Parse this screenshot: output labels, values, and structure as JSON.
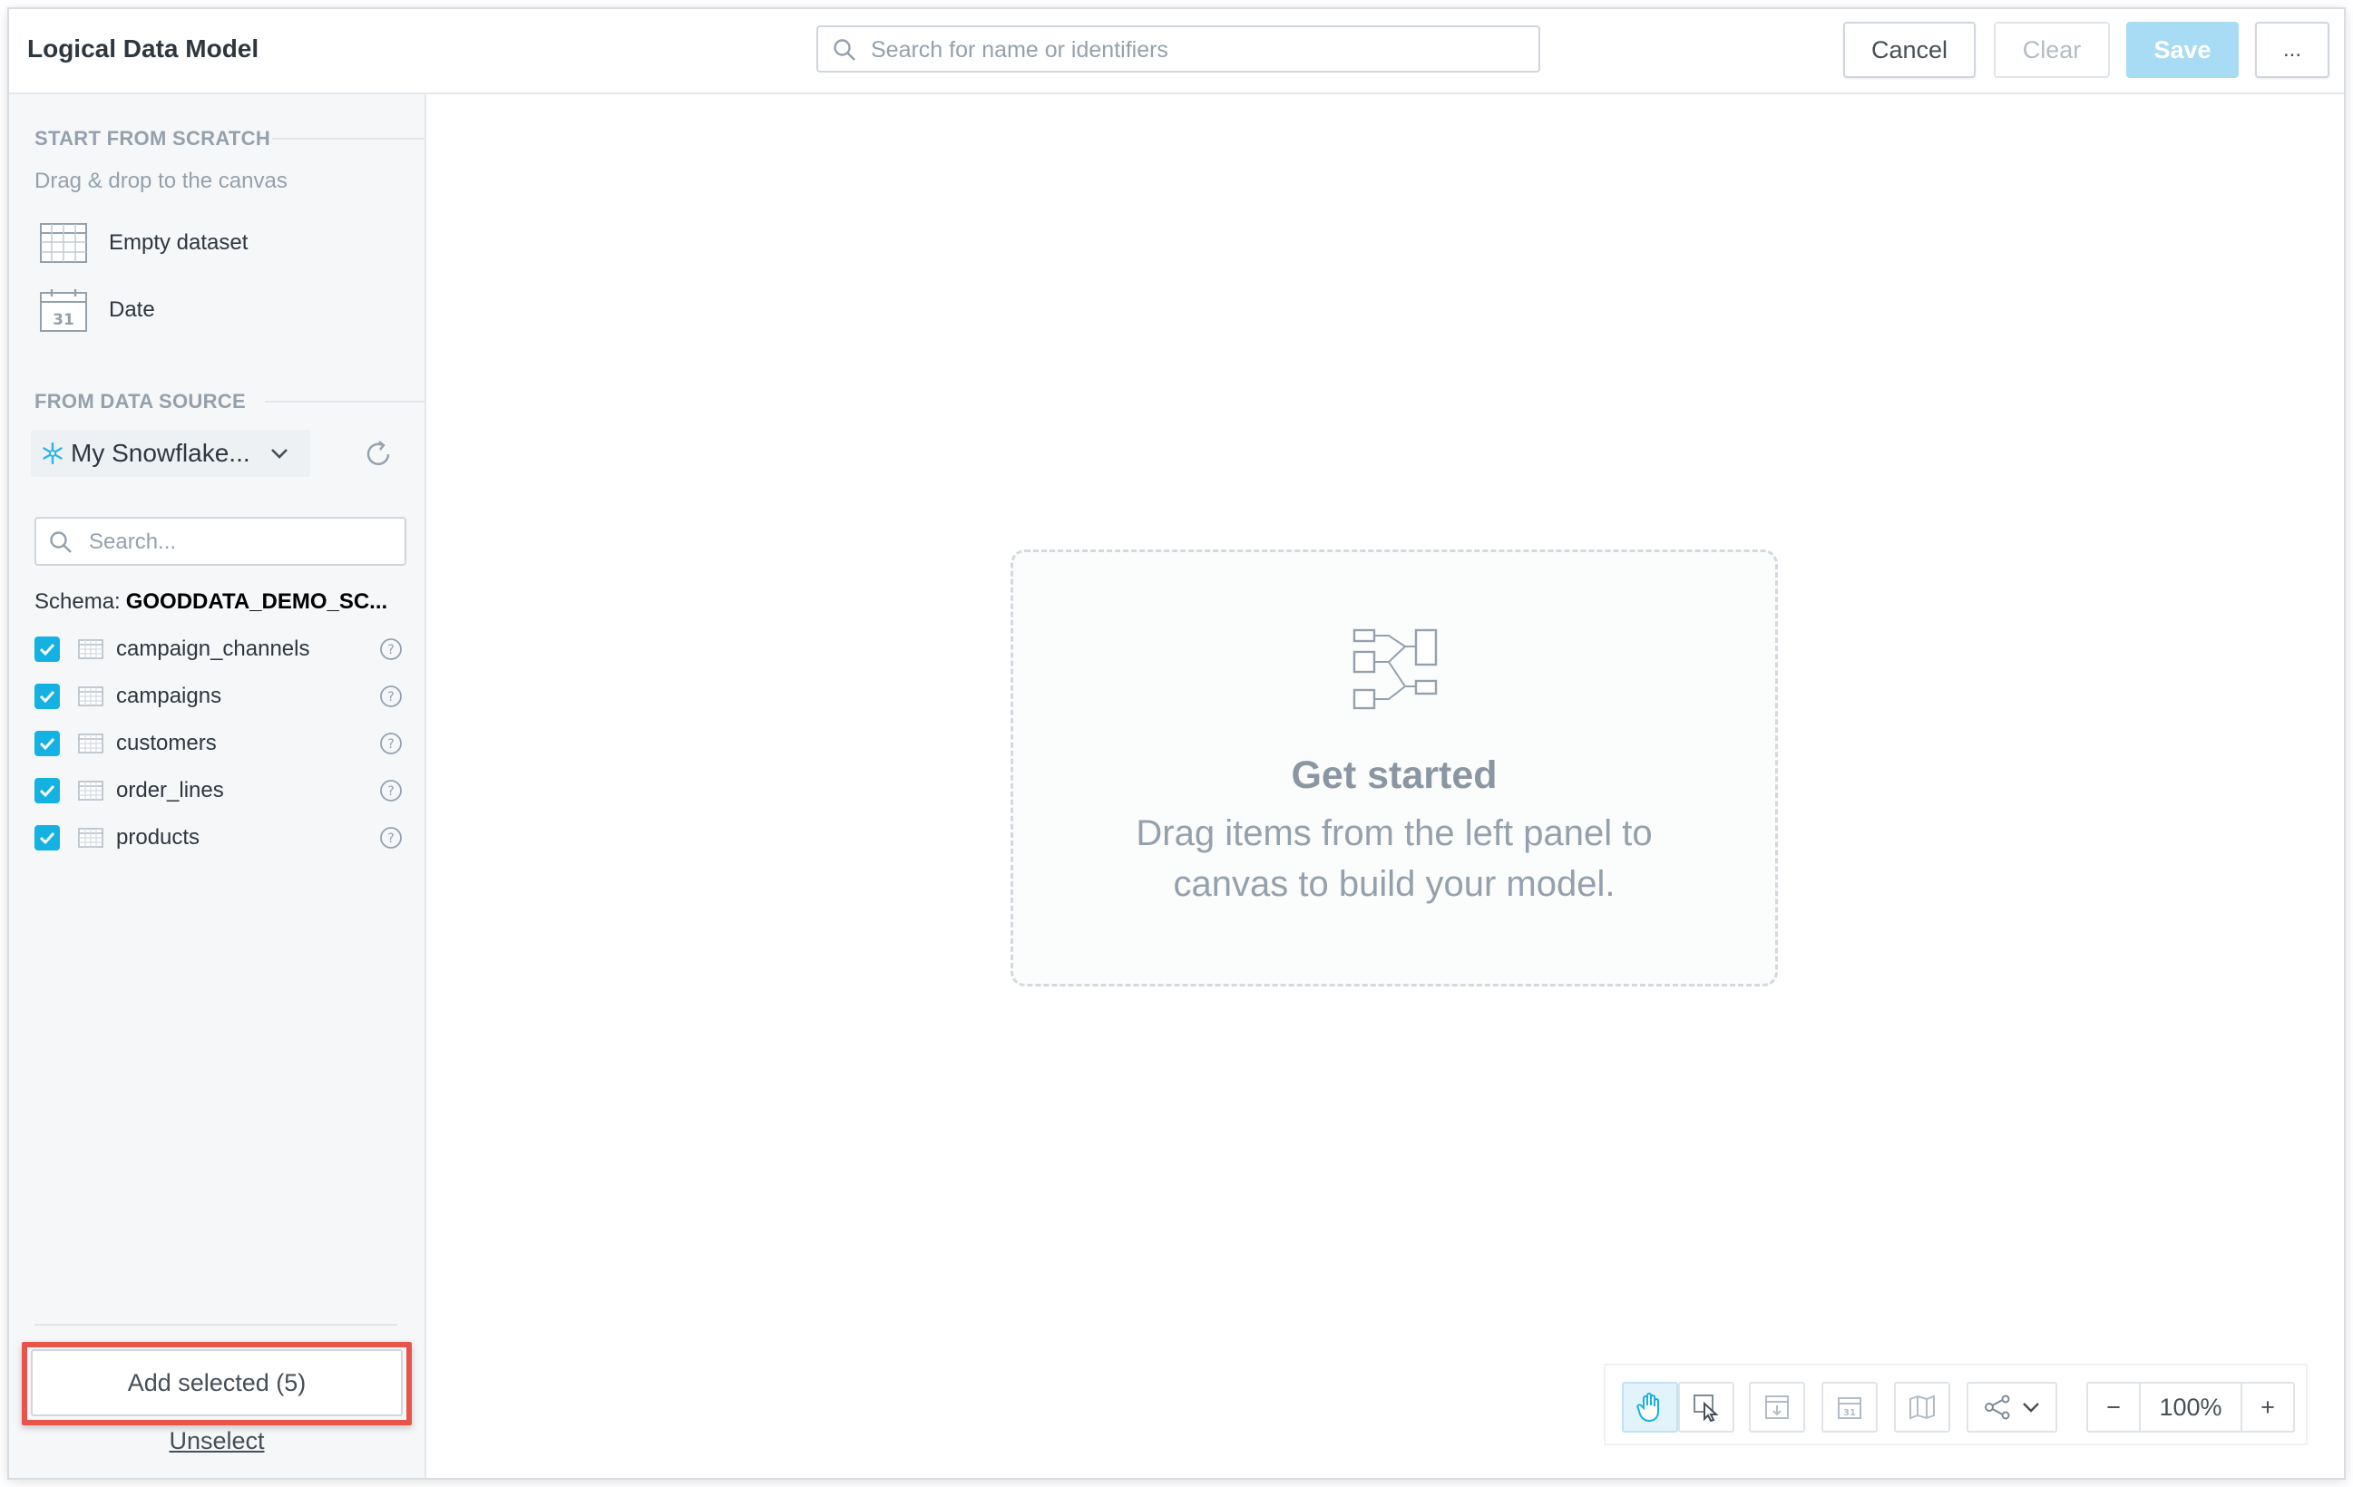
{
  "header": {
    "title": "Logical Data Model",
    "search_placeholder": "Search for name or identifiers",
    "cancel_label": "Cancel",
    "clear_label": "Clear",
    "save_label": "Save",
    "more_label": "..."
  },
  "sidebar": {
    "scratch": {
      "title": "START FROM SCRATCH",
      "hint": "Drag & drop to the canvas",
      "items": [
        {
          "label": "Empty dataset",
          "icon": "table-grid-icon"
        },
        {
          "label": "Date",
          "icon": "calendar-icon"
        }
      ]
    },
    "source": {
      "title": "FROM DATA SOURCE",
      "datasource_name": "My Snowflake...",
      "search_placeholder": "Search...",
      "schema_label": "Schema:",
      "schema_name": "GOODDATA_DEMO_SC...",
      "tables": [
        {
          "name": "campaign_channels",
          "checked": true
        },
        {
          "name": "campaigns",
          "checked": true
        },
        {
          "name": "customers",
          "checked": true
        },
        {
          "name": "order_lines",
          "checked": true
        },
        {
          "name": "products",
          "checked": true
        }
      ]
    },
    "add_selected_label": "Add selected (5)",
    "unselect_label": "Unselect"
  },
  "canvas": {
    "empty_title": "Get started",
    "empty_text": "Drag items from the left panel to canvas to build your model."
  },
  "toolbar": {
    "zoom_level": "100%",
    "zoom_out_label": "−",
    "zoom_in_label": "+"
  },
  "colors": {
    "accent": "#14b2e2",
    "save_disabled": "#a8dcf4",
    "highlight": "#e8534a"
  }
}
